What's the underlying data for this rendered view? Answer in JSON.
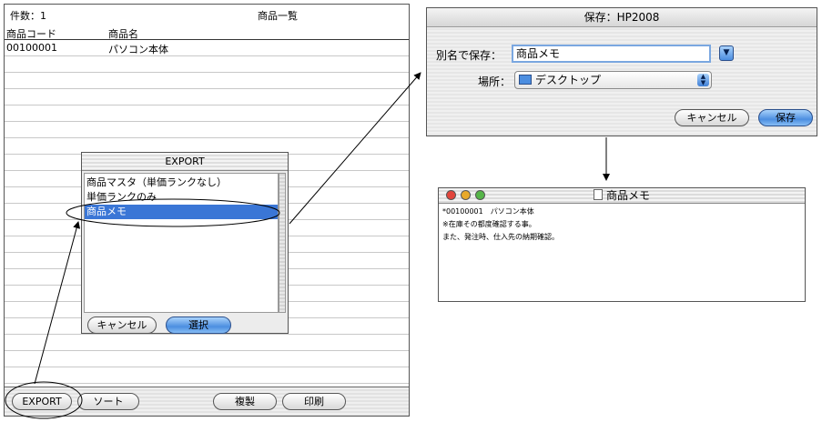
{
  "list_window": {
    "count_label": "件数：1",
    "title": "商品一覧",
    "columns": [
      "商品コード",
      "商品名"
    ],
    "rows": [
      {
        "code": "00100001",
        "name": "パソコン本体"
      }
    ],
    "buttons": {
      "export": "EXPORT",
      "sort": "ソート",
      "copy": "複製",
      "print": "印刷"
    }
  },
  "export_dialog": {
    "title": "EXPORT",
    "items": [
      "商品マスタ（単価ランクなし）",
      "単価ランクのみ",
      "商品メモ"
    ],
    "selected_item": "商品メモ",
    "cancel_label": "キャンセル",
    "select_label": "選択"
  },
  "save_dialog": {
    "title": "保存：HP2008",
    "saveas_label": "別名で保存：",
    "saveas_value": "商品メモ",
    "place_label": "場所：",
    "place_value": "デスクトップ",
    "cancel_label": "キャンセル",
    "save_label": "保存"
  },
  "note_window": {
    "title": "商品メモ",
    "lines": [
      "*00100001　パソコン本体",
      "※在庫その都度確認する事。",
      "また、発注時、仕入先の納期確認。"
    ]
  },
  "colors": {
    "selection_blue": "#3a76d6",
    "aqua_button": "#4c8ee0",
    "close_red": "#e2453c",
    "minimize_yellow": "#e8a92a",
    "zoom_green": "#55b548"
  }
}
